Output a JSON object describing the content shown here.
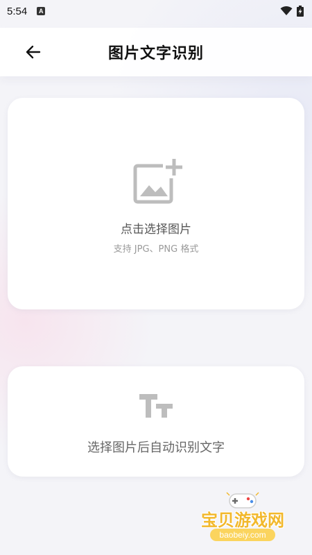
{
  "status_bar": {
    "time": "5:54",
    "notification_icon": "a-icon",
    "wifi_icon": "wifi-icon",
    "battery_icon": "battery-charging-icon"
  },
  "app_bar": {
    "back_icon": "arrow-left-icon",
    "title": "图片文字识别"
  },
  "upload_card": {
    "icon": "add-image-icon",
    "title": "点击选择图片",
    "subtitle": "支持 JPG、PNG 格式"
  },
  "info_card": {
    "icon": "text-size-icon",
    "text": "选择图片后自动识别文字"
  },
  "watermark": {
    "title": "宝贝游戏网",
    "url": "baobeiy.com"
  },
  "colors": {
    "icon_gray": "#bdbdbd",
    "watermark_yellow": "#f2b82c"
  }
}
